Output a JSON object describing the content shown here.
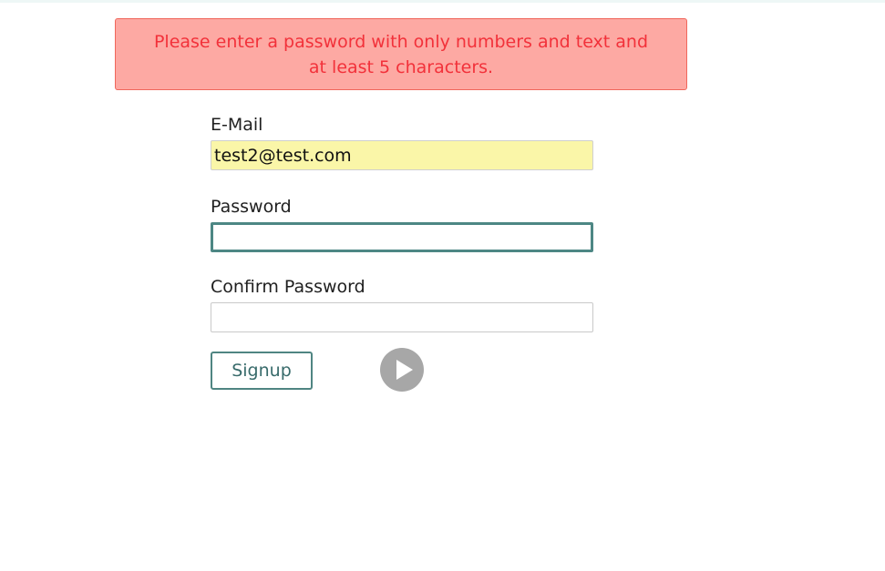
{
  "error": {
    "message": "Please enter a password with only numbers and text and at least 5 characters."
  },
  "form": {
    "email": {
      "label": "E-Mail",
      "value": "test2@test.com"
    },
    "password": {
      "label": "Password",
      "value": ""
    },
    "confirm_password": {
      "label": "Confirm Password",
      "value": ""
    },
    "signup_label": "Signup"
  },
  "overlay": {
    "play_icon": "play-icon"
  },
  "colors": {
    "error_background": "#fda9a3",
    "error_text": "#f2313a",
    "accent": "#4d8784",
    "autofill_background": "#faf6a8"
  }
}
